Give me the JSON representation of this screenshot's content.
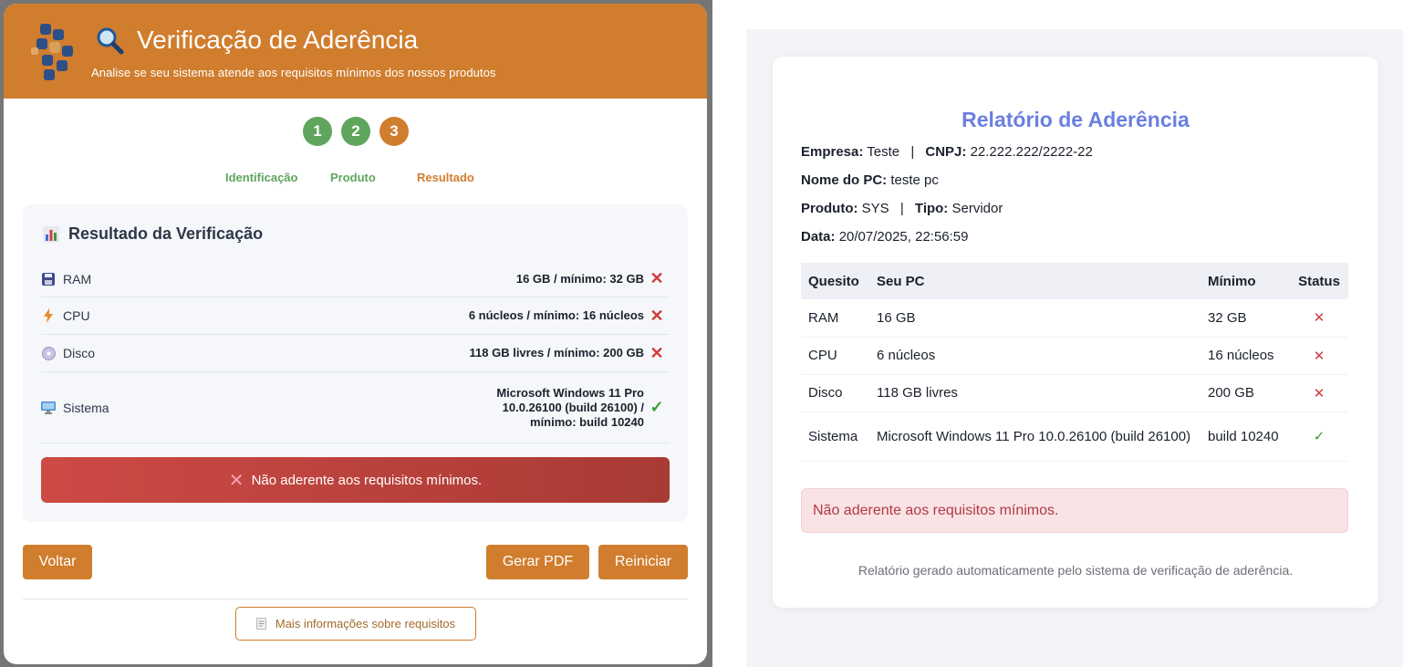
{
  "header": {
    "title": "Verificação de Aderência",
    "subtitle": "Analise se seu sistema atende aos requisitos mínimos dos nossos produtos",
    "accent": "#d07d2e"
  },
  "steps": [
    {
      "num": "1",
      "label": "Identificação",
      "state": "done"
    },
    {
      "num": "2",
      "label": "Produto",
      "state": "done"
    },
    {
      "num": "3",
      "label": "Resultado",
      "state": "current"
    }
  ],
  "result": {
    "title": "Resultado da Verificação",
    "rows": [
      {
        "icon": "floppy-disk-icon",
        "name": "RAM",
        "value": "16 GB / mínimo: 32 GB",
        "status": "fail"
      },
      {
        "icon": "lightning-icon",
        "name": "CPU",
        "value": "6 núcleos / mínimo: 16 núcleos",
        "status": "fail"
      },
      {
        "icon": "disc-icon",
        "name": "Disco",
        "value": "118 GB livres / mínimo: 200 GB",
        "status": "fail"
      },
      {
        "icon": "monitor-icon",
        "name": "Sistema",
        "value_lines": [
          "Microsoft Windows 11 Pro",
          "10.0.26100 (build 26100) /",
          "mínimo: build 10240"
        ],
        "status": "pass"
      }
    ],
    "banner": "Não aderente aos requisitos mínimos."
  },
  "buttons": {
    "back": "Voltar",
    "pdf": "Gerar PDF",
    "restart": "Reiniciar",
    "more_info": "Mais informações sobre requisitos"
  },
  "report": {
    "title": "Relatório de Aderência",
    "empresa_label": "Empresa:",
    "empresa": "Teste",
    "cnpj_label": "CNPJ:",
    "cnpj": "22.222.222/2222-22",
    "pc_label": "Nome do PC:",
    "pc": "teste pc",
    "produto_label": "Produto:",
    "produto": "SYS",
    "tipo_label": "Tipo:",
    "tipo": "Servidor",
    "data_label": "Data:",
    "data": "20/07/2025, 22:56:59",
    "columns": [
      "Quesito",
      "Seu PC",
      "Mínimo",
      "Status"
    ],
    "rows": [
      {
        "quesito": "RAM",
        "seu_pc": "16 GB",
        "minimo": "32 GB",
        "status": "✕"
      },
      {
        "quesito": "CPU",
        "seu_pc": "6 núcleos",
        "minimo": "16 núcleos",
        "status": "✕"
      },
      {
        "quesito": "Disco",
        "seu_pc": "118 GB livres",
        "minimo": "200 GB",
        "status": "✕"
      },
      {
        "quesito": "Sistema",
        "seu_pc": "Microsoft Windows 11 Pro 10.0.26100 (build 26100)",
        "minimo": "build 10240",
        "status": "✓"
      }
    ],
    "alert": "Não aderente aos requisitos mínimos.",
    "footer": "Relatório gerado automaticamente pelo sistema de verificação de aderência."
  },
  "colors": {
    "accent": "#d07d2e",
    "success": "#5fa55d",
    "fail": "#d23b3b",
    "report_title": "#6b7fe0"
  }
}
